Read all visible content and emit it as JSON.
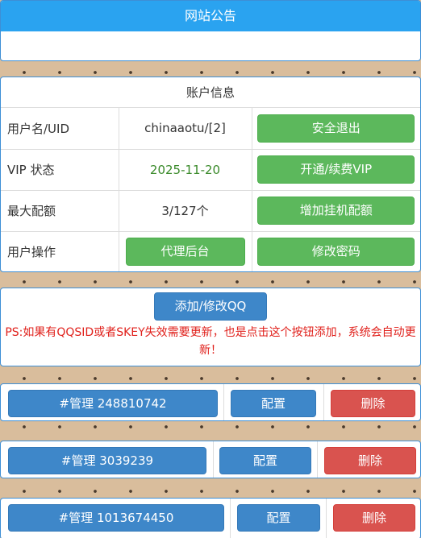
{
  "notice": {
    "title": "网站公告"
  },
  "account": {
    "title": "账户信息",
    "rows": [
      {
        "label": "用户名/UID",
        "value": "chinaaotu/[2]",
        "action": "安全退出"
      },
      {
        "label": "VIP 状态",
        "value": "2025-11-20",
        "action": "开通/续费VIP"
      },
      {
        "label": "最大配额",
        "value": "3/127个",
        "action": "增加挂机配额"
      }
    ],
    "ops": {
      "label": "用户操作",
      "agent_button": "代理后台",
      "password_button": "修改密码"
    }
  },
  "qq": {
    "add_button": "添加/修改QQ",
    "ps": "PS:如果有QQSID或者SKEY失效需要更新，也是点击这个按钮添加，系统会自动更新！"
  },
  "accounts": [
    {
      "manage": "#管理 248810742",
      "config": "配置",
      "delete": "删除"
    },
    {
      "manage": "#管理 3039239",
      "config": "配置",
      "delete": "删除"
    },
    {
      "manage": "#管理 1013674450",
      "config": "配置",
      "delete": "删除"
    }
  ],
  "colors": {
    "header": "#2aa3f0",
    "green": "#5cb85c",
    "blue": "#3e87c9",
    "red": "#d9534f",
    "ps_text": "#e0201b"
  }
}
